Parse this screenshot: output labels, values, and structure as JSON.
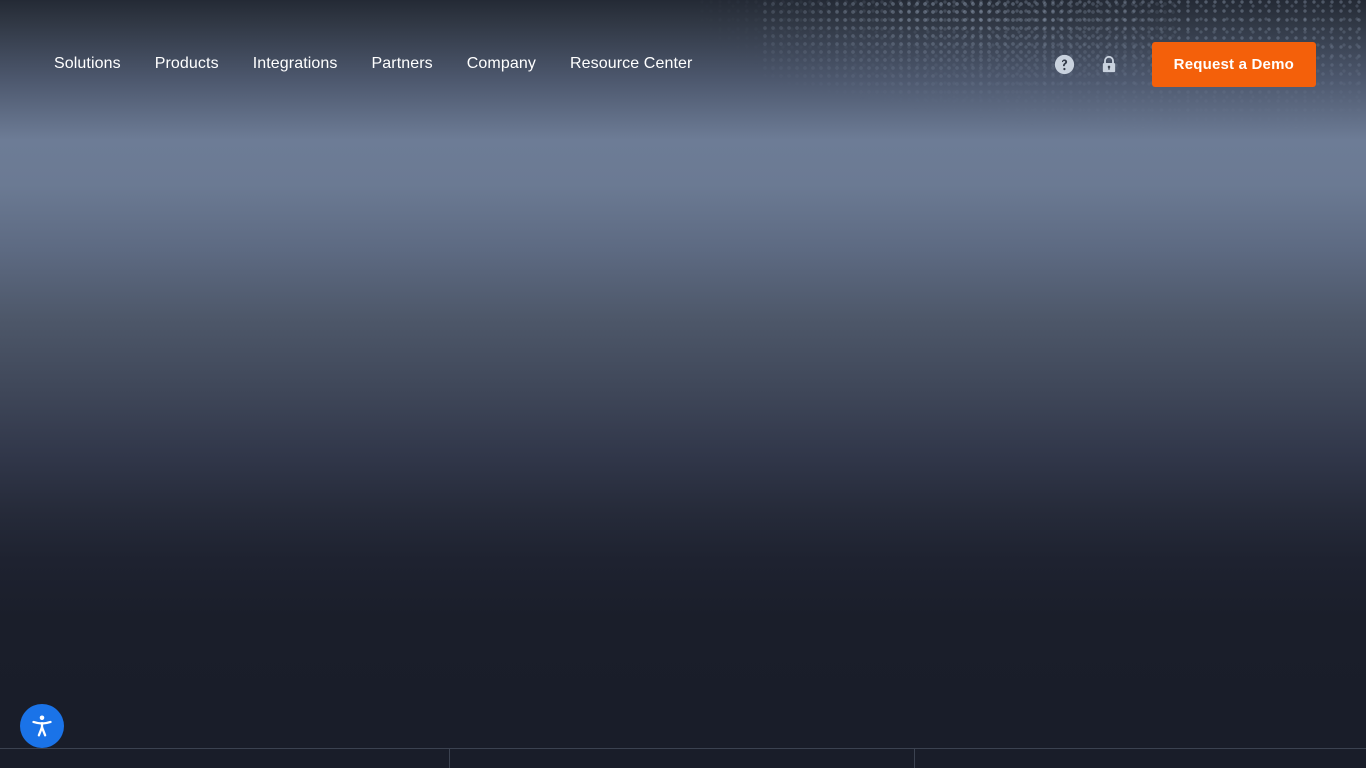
{
  "nav": {
    "links": [
      {
        "label": "Solutions",
        "name": "nav-link-solutions"
      },
      {
        "label": "Products",
        "name": "nav-link-products"
      },
      {
        "label": "Integrations",
        "name": "nav-link-integrations"
      },
      {
        "label": "Partners",
        "name": "nav-link-partners"
      },
      {
        "label": "Company",
        "name": "nav-link-company"
      },
      {
        "label": "Resource Center",
        "name": "nav-link-resource-center"
      }
    ],
    "help_icon": "help-circle-icon",
    "lock_icon": "lock-icon",
    "cta_label": "Request a Demo"
  },
  "accessibility": {
    "icon": "accessibility-person-icon",
    "label": "Accessibility"
  },
  "colors": {
    "accent_orange": "#f4600a",
    "accessibility_blue": "#1a73e8",
    "hero_top": "#242a35",
    "hero_mid_light": "#6d7c96",
    "hero_bottom": "#191d29",
    "divider": "#3b4250",
    "nav_text": "#ffffff",
    "icon_fill": "#c9d2de"
  }
}
